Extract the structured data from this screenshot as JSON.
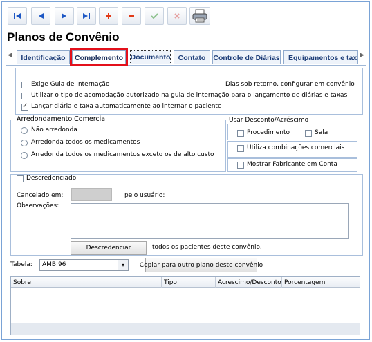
{
  "toolbar": {
    "buttons": [
      "first-record",
      "previous-record",
      "next-record",
      "last-record",
      "add-record",
      "delete-record",
      "confirm",
      "cancel",
      "print"
    ]
  },
  "page_title": "Planos de Convênio",
  "tabs": [
    "Identificação",
    "Complemento",
    "Documento",
    "Contato",
    "Controle de Diárias",
    "Equipamentos e taxas"
  ],
  "active_tab": "Complemento",
  "options": {
    "exige_guia": "Exige Guia de Internação",
    "utilizar_tipo": "Utilizar o tipo de acomodação autorizado na guia de internação para o lançamento de diárias e taxas",
    "lancar_diaria": "Lançar diária e taxa automaticamente ao internar o paciente",
    "dias_retorno": "Dias sob retorno, configurar em convênio"
  },
  "arredondamento": {
    "title": "Arredondamento Comercial",
    "items": [
      "Não arredonda",
      "Arredonda todos os medicamentos",
      "Arredonda todos os medicamentos exceto os de alto custo"
    ]
  },
  "desconto": {
    "title": "Usar Desconto/Acréscimo",
    "procedimento": "Procedimento",
    "sala": "Sala",
    "combinacoes": "Utiliza combinações comerciais",
    "fabricante": "Mostrar Fabricante em Conta"
  },
  "descredenciado": {
    "label": "Descredenciado",
    "cancelado_em": "Cancelado em:",
    "pelo_usuario": "pelo usuário:",
    "observacoes": "Observações:",
    "button": "Descredenciar",
    "after_button": "todos os pacientes deste convênio."
  },
  "tabela": {
    "label": "Tabela:",
    "value": "AMB 96",
    "copy_button": "Copiar para outro plano deste convênio"
  },
  "grid": {
    "columns": [
      "Sobre",
      "Tipo",
      "Acrescimo/Desconto",
      "Porcentagem"
    ]
  }
}
